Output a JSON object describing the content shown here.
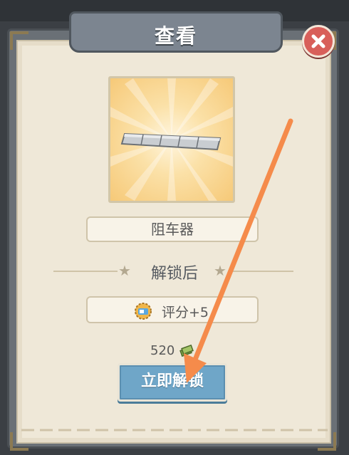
{
  "dialog": {
    "title": "查看",
    "item_name": "阻车器",
    "unlock_section_title": "解锁后",
    "reward_text": "评分+5",
    "price": "520",
    "unlock_button": "立即解锁"
  },
  "icons": {
    "close": "close-x-icon",
    "reward": "rating-badge-icon",
    "currency": "cash-stack-icon",
    "item": "road-barrier-icon"
  },
  "colors": {
    "button": "#6fa6c8",
    "close": "#d85f5a",
    "panel": "#efe8d8",
    "annotation_arrow": "#f58b4b"
  }
}
